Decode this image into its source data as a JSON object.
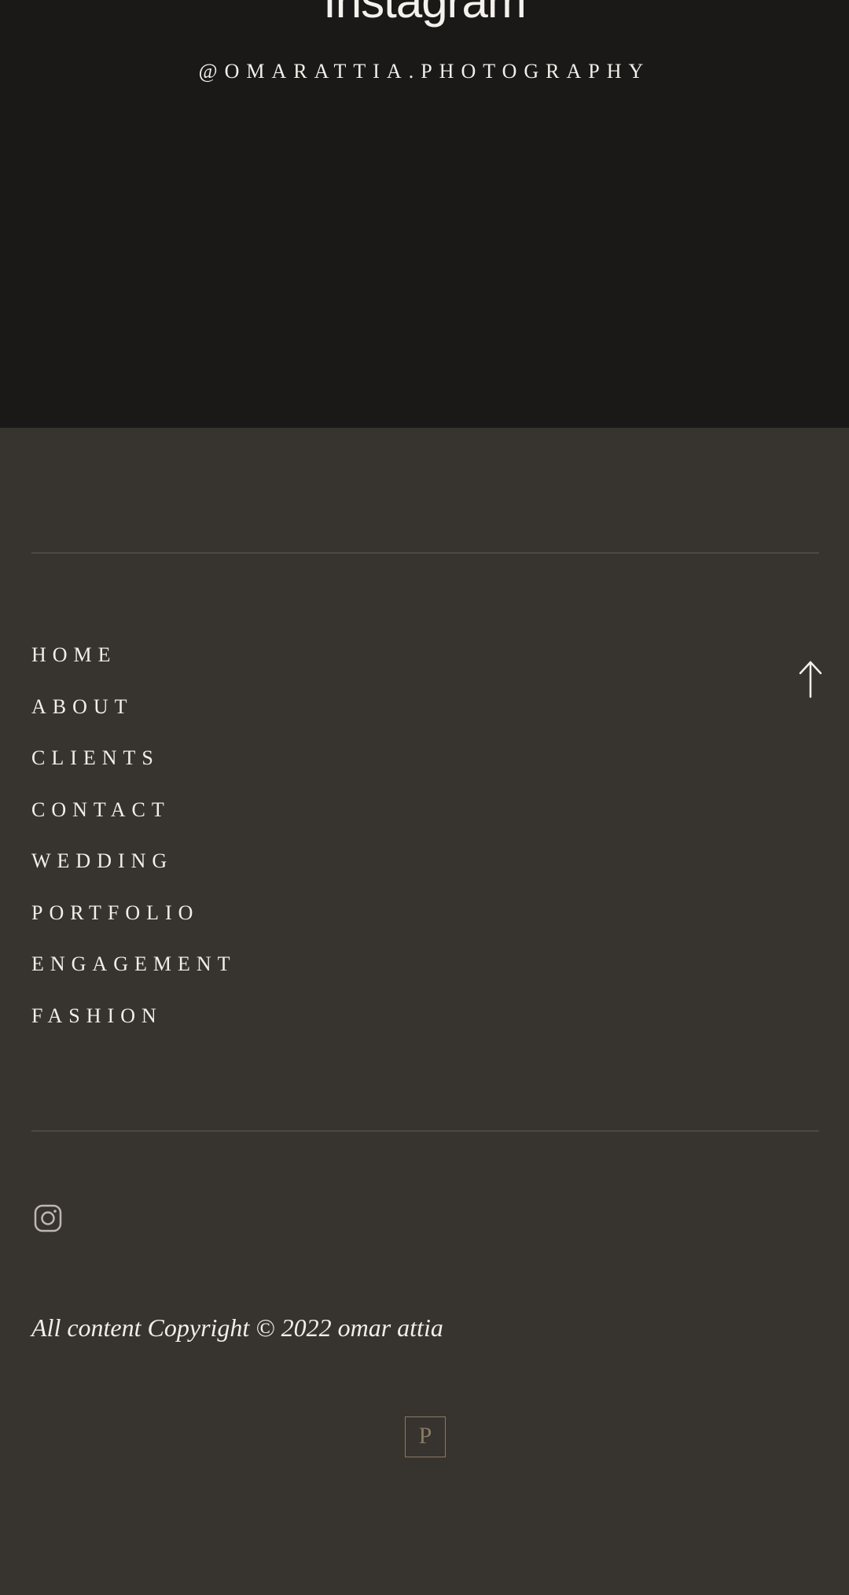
{
  "instagram": {
    "title": "Instagram",
    "handle": "@OMARATTIA.PHOTOGRAPHY"
  },
  "footer": {
    "nav": [
      {
        "label": "HOME"
      },
      {
        "label": "ABOUT"
      },
      {
        "label": "CLIENTS"
      },
      {
        "label": "CONTACT"
      },
      {
        "label": "WEDDING"
      },
      {
        "label": "PORTFOLIO"
      },
      {
        "label": "ENGAGEMENT"
      },
      {
        "label": "FASHION"
      }
    ],
    "back_to_top_icon": "arrow-up-icon",
    "social_icon": "instagram-icon",
    "copyright": "All content Copyright © 2022 omar attia",
    "badge_letter": "P"
  },
  "colors": {
    "instagram_background": "#1b1918",
    "footer_background": "#37332f",
    "text": "#f2efe9",
    "divider": "#4c4843",
    "badge_accent": "#8a7b62"
  }
}
